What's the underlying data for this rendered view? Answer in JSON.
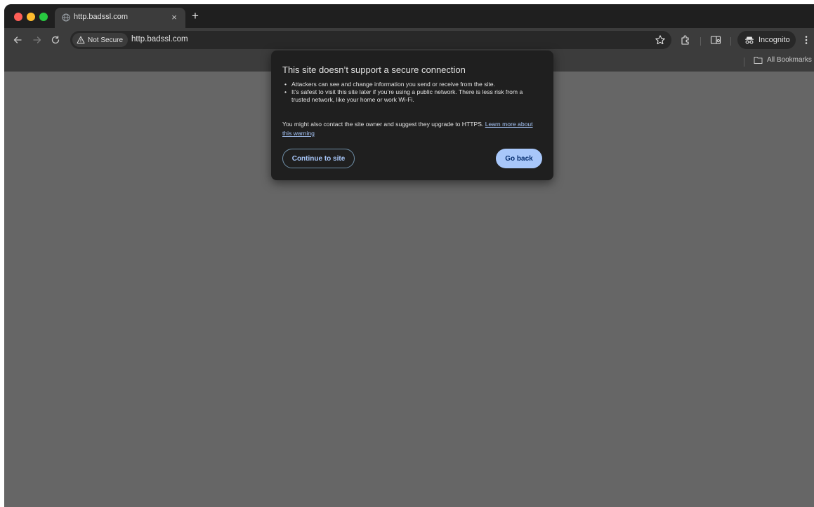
{
  "window": {
    "traffic_lights": [
      "close",
      "minimize",
      "zoom"
    ]
  },
  "tab": {
    "title": "http.badssl.com",
    "favicon": "globe-icon",
    "close_glyph": "×"
  },
  "new_tab_glyph": "+",
  "toolbar": {
    "back_icon": "arrow-left-icon",
    "forward_icon": "arrow-right-icon",
    "reload_icon": "reload-icon",
    "security_chip_label": "Not Secure",
    "url": "http.badssl.com",
    "incognito_label": "Incognito"
  },
  "bookmarks": {
    "all_bookmarks_label": "All Bookmarks"
  },
  "popup": {
    "title": "This site doesn’t support a secure connection",
    "bullets": [
      "Attackers can see and change information you send or receive from the site.",
      "It’s safest to visit this site later if you’re using a public network. There is less risk from a trusted network, like your home or work Wi-Fi."
    ],
    "note_text": "You might also contact the site owner and suggest they upgrade to HTTPS. ",
    "note_link": "Learn more about this warning",
    "continue_label": "Continue to site",
    "back_label": "Go back"
  },
  "colors": {
    "chrome_dark": "#1f1f1f",
    "toolbar": "#3c3c3c",
    "content": "#666666",
    "accent": "#a8c7fa"
  }
}
